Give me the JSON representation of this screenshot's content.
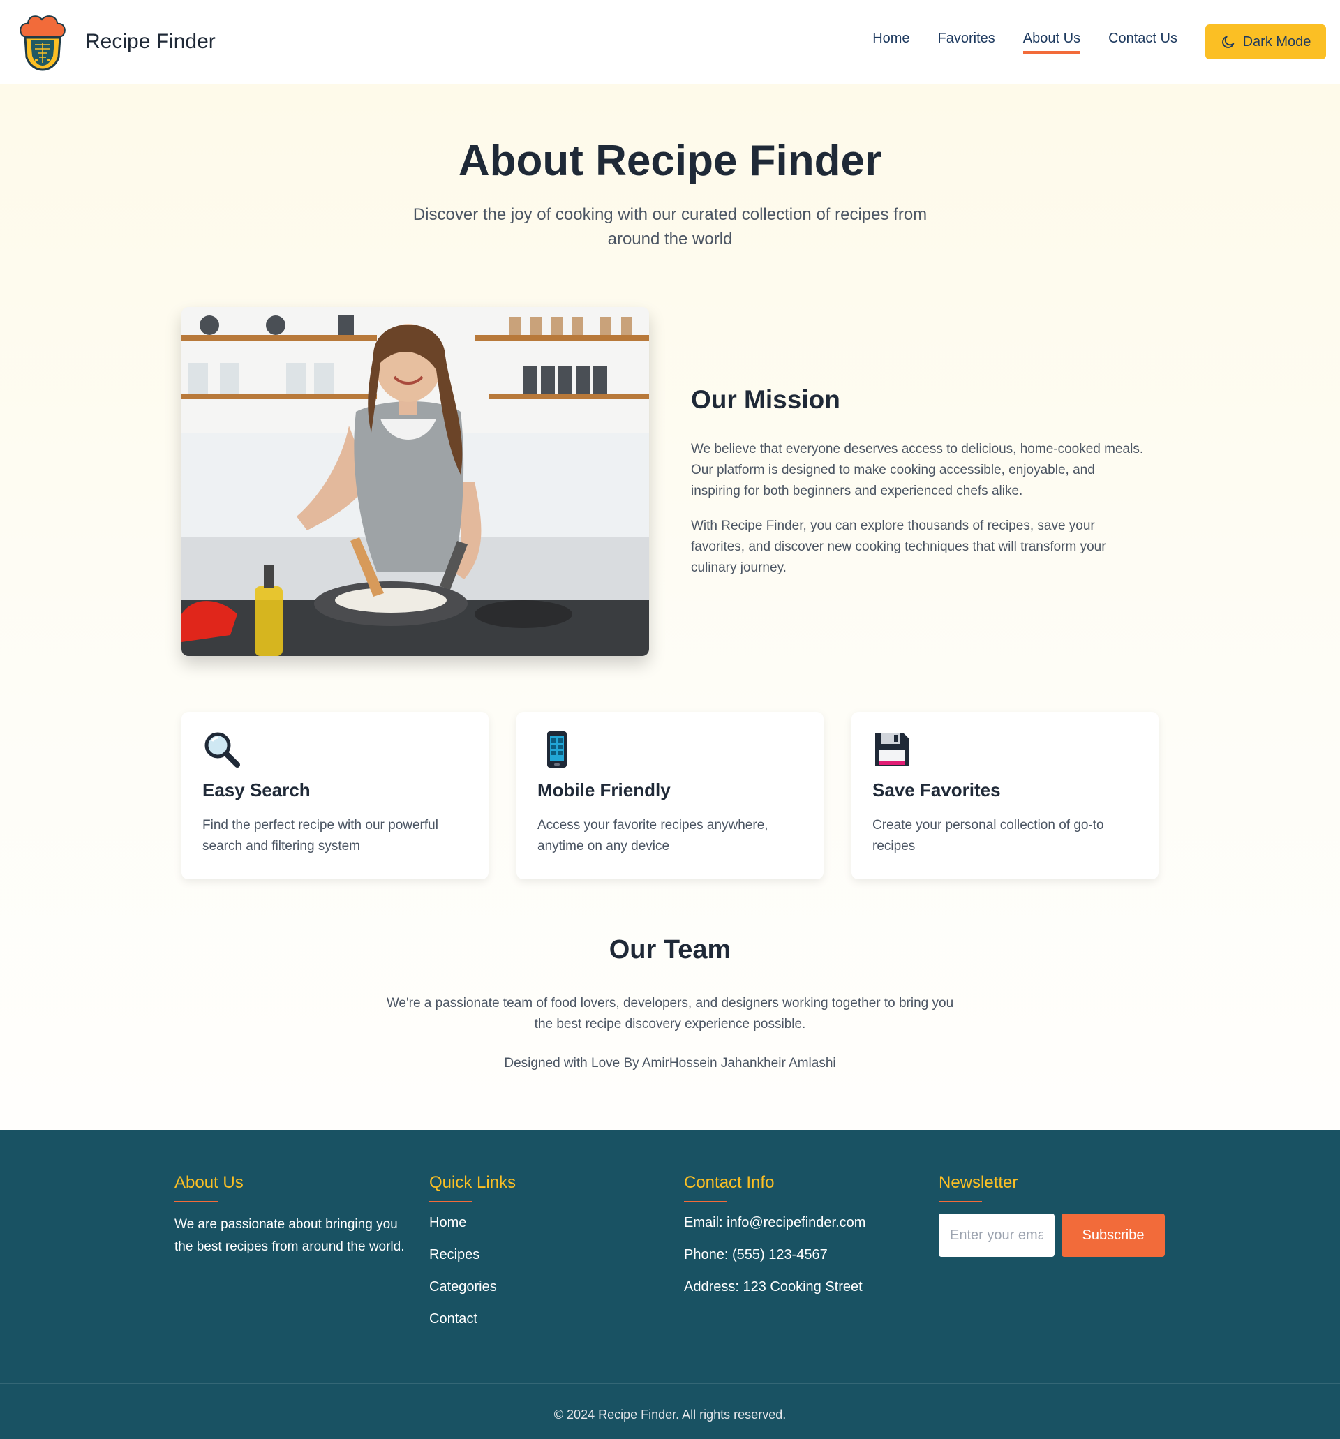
{
  "header": {
    "brand": "Recipe Finder",
    "nav": [
      "Home",
      "Favorites",
      "About Us",
      "Contact Us"
    ],
    "active_nav": "About Us",
    "dark_mode_label": "Dark Mode"
  },
  "hero": {
    "title": "About Recipe Finder",
    "subtitle": "Discover the joy of cooking with our curated collection of recipes from around the world"
  },
  "mission": {
    "title": "Our Mission",
    "paragraphs": [
      "We believe that everyone deserves access to delicious, home-cooked meals. Our platform is designed to make cooking accessible, enjoyable, and inspiring for both beginners and experienced chefs alike.",
      "With Recipe Finder, you can explore thousands of recipes, save your favorites, and discover new cooking techniques that will transform your culinary journey."
    ]
  },
  "features": [
    {
      "icon": "magnifying-glass-icon",
      "title": "Easy Search",
      "desc": "Find the perfect recipe with our powerful search and filtering system"
    },
    {
      "icon": "mobile-phone-icon",
      "title": "Mobile Friendly",
      "desc": "Access your favorite recipes anywhere, anytime on any device"
    },
    {
      "icon": "floppy-disk-icon",
      "title": "Save Favorites",
      "desc": "Create your personal collection of go-to recipes"
    }
  ],
  "team": {
    "title": "Our Team",
    "desc": "We're a passionate team of food lovers, developers, and designers working together to bring you the best recipe discovery experience possible.",
    "credit": "Designed with Love By AmirHossein Jahankheir Amlashi"
  },
  "footer": {
    "about": {
      "title": "About Us",
      "text": "We are passionate about bringing you the best recipes from around the world."
    },
    "quick_links": {
      "title": "Quick Links",
      "links": [
        "Home",
        "Recipes",
        "Categories",
        "Contact"
      ]
    },
    "contact": {
      "title": "Contact Info",
      "lines": [
        "Email: info@recipefinder.com",
        "Phone: (555) 123-4567",
        "Address: 123 Cooking Street"
      ]
    },
    "newsletter": {
      "title": "Newsletter",
      "placeholder": "Enter your email",
      "button": "Subscribe"
    },
    "copyright": "© 2024 Recipe Finder. All rights reserved."
  },
  "colors": {
    "accent_orange": "#f26b3a",
    "accent_yellow": "#fbbf24",
    "footer_bg": "#195263"
  }
}
